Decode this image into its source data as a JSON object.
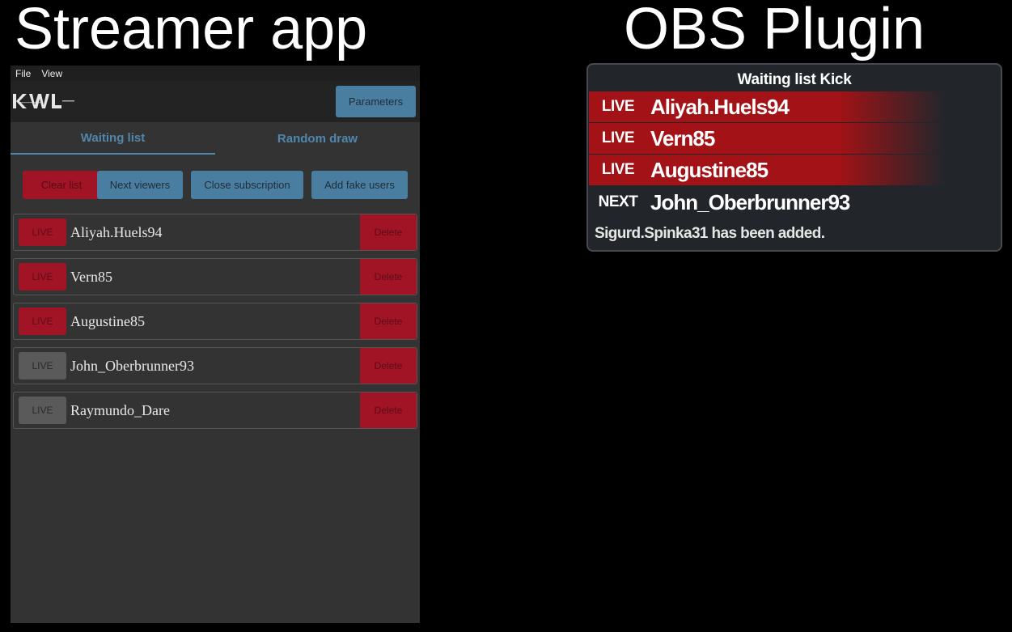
{
  "captions": {
    "left": "Streamer app",
    "right": "OBS Plugin"
  },
  "app": {
    "menu": [
      "File",
      "View"
    ],
    "logo_icon": "kwl-logo",
    "parameters_label": "Parameters",
    "tabs": [
      {
        "label": "Waiting list",
        "active": true
      },
      {
        "label": "Random draw",
        "active": false
      }
    ],
    "actions": {
      "clear": "Clear list",
      "next": "Next viewers",
      "close": "Close subscription",
      "fake": "Add fake users"
    },
    "rows": [
      {
        "tag": "LIVE",
        "live": true,
        "name": "Aliyah.Huels94",
        "delete": "Delete"
      },
      {
        "tag": "LIVE",
        "live": true,
        "name": "Vern85",
        "delete": "Delete"
      },
      {
        "tag": "LIVE",
        "live": true,
        "name": "Augustine85",
        "delete": "Delete"
      },
      {
        "tag": "LIVE",
        "live": false,
        "name": "John_Oberbrunner93",
        "delete": "Delete"
      },
      {
        "tag": "LIVE",
        "live": false,
        "name": "Raymundo_Dare",
        "delete": "Delete"
      }
    ],
    "colors": {
      "accent": "#4a7ea0",
      "danger": "#a01425",
      "panel": "#333333"
    }
  },
  "obs": {
    "title": "Waiting list Kick",
    "rows": [
      {
        "tag": "LIVE",
        "name": "Aliyah.Huels94"
      },
      {
        "tag": "LIVE",
        "name": "Vern85"
      },
      {
        "tag": "LIVE",
        "name": "Augustine85"
      },
      {
        "tag": "NEXT",
        "name": "John_Oberbrunner93"
      }
    ],
    "message": "Sigurd.Spinka31 has been added.",
    "colors": {
      "live": "#a31216",
      "background": "#22262b"
    }
  }
}
